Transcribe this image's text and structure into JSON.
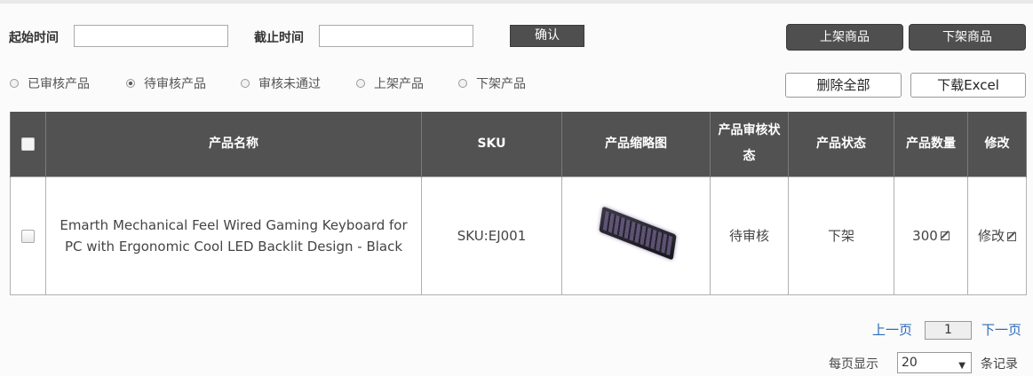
{
  "filter": {
    "start_label": "起始时间",
    "start_value": "",
    "end_label": "截止时间",
    "end_value": "",
    "confirm_label": "确认"
  },
  "actions": {
    "list_on": "上架商品",
    "list_off": "下架商品",
    "delete_all": "删除全部",
    "download_excel": "下载Excel"
  },
  "status_filters": [
    {
      "label": "已审核产品",
      "selected": false
    },
    {
      "label": "待审核产品",
      "selected": true
    },
    {
      "label": "审核未通过",
      "selected": false
    },
    {
      "label": "上架产品",
      "selected": false
    },
    {
      "label": "下架产品",
      "selected": false
    }
  ],
  "table": {
    "headers": {
      "name": "产品名称",
      "sku": "SKU",
      "thumb": "产品缩略图",
      "review_status": "产品审核状态",
      "product_status": "产品状态",
      "quantity": "产品数量",
      "edit": "修改"
    },
    "rows": [
      {
        "name": "Emarth Mechanical Feel Wired Gaming Keyboard for PC with Ergonomic Cool LED Backlit Design - Black",
        "sku": "SKU:EJ001",
        "review_status": "待审核",
        "product_status": "下架",
        "quantity": "300",
        "edit_label": "修改"
      }
    ]
  },
  "pagination": {
    "prev": "上一页",
    "current": "1",
    "next": "下一页",
    "per_page_label": "每页显示",
    "per_page_value": "20",
    "records_label": "条记录"
  }
}
